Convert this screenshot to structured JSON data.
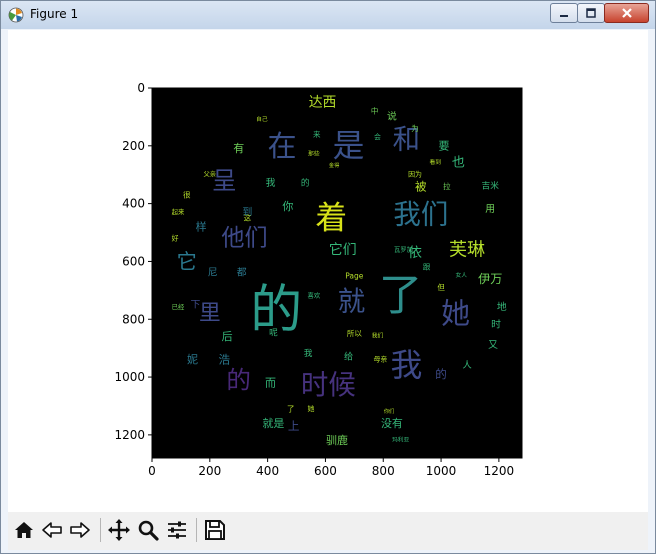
{
  "window": {
    "title": "Figure 1"
  },
  "chart_data": {
    "type": "heatmap",
    "subtype": "word-cloud image",
    "colormap": "viridis",
    "background": "#000000",
    "x_ticks": [
      "0",
      "200",
      "400",
      "600",
      "800",
      "1000",
      "1200"
    ],
    "y_ticks": [
      "0",
      "200",
      "400",
      "600",
      "800",
      "1000",
      "1200"
    ],
    "xlim": [
      0,
      1280
    ],
    "ylim": [
      1280,
      0
    ],
    "words": [
      {
        "text": "的",
        "x": 430,
        "y": 770,
        "size": 180,
        "color": "#2c9c8a"
      },
      {
        "text": "了",
        "x": 860,
        "y": 720,
        "size": 150,
        "color": "#2e8e8c"
      },
      {
        "text": "是",
        "x": 680,
        "y": 200,
        "size": 110,
        "color": "#3b528b"
      },
      {
        "text": "在",
        "x": 450,
        "y": 200,
        "size": 100,
        "color": "#3b528b"
      },
      {
        "text": "和",
        "x": 880,
        "y": 180,
        "size": 95,
        "color": "#3b528b"
      },
      {
        "text": "着",
        "x": 620,
        "y": 450,
        "size": 110,
        "color": "#d8e219"
      },
      {
        "text": "我们",
        "x": 930,
        "y": 440,
        "size": 95,
        "color": "#2c728e"
      },
      {
        "text": "她",
        "x": 1050,
        "y": 780,
        "size": 100,
        "color": "#3e4a89"
      },
      {
        "text": "就",
        "x": 690,
        "y": 740,
        "size": 95,
        "color": "#3b528b"
      },
      {
        "text": "我",
        "x": 880,
        "y": 960,
        "size": 110,
        "color": "#3e4a89"
      },
      {
        "text": "时候",
        "x": 610,
        "y": 1030,
        "size": 95,
        "color": "#46327e"
      },
      {
        "text": "的",
        "x": 300,
        "y": 1010,
        "size": 85,
        "color": "#482878"
      },
      {
        "text": "他们",
        "x": 320,
        "y": 520,
        "size": 80,
        "color": "#3e4a89"
      },
      {
        "text": "呈",
        "x": 250,
        "y": 320,
        "size": 85,
        "color": "#3e4a89"
      },
      {
        "text": "它",
        "x": 120,
        "y": 600,
        "size": 70,
        "color": "#2a788e"
      },
      {
        "text": "里",
        "x": 200,
        "y": 780,
        "size": 75,
        "color": "#3e4a89"
      },
      {
        "text": "芙琳",
        "x": 1090,
        "y": 560,
        "size": 62,
        "color": "#b5de2b"
      },
      {
        "text": "达西",
        "x": 590,
        "y": 50,
        "size": 48,
        "color": "#b5de2b"
      },
      {
        "text": "它们",
        "x": 660,
        "y": 560,
        "size": 48,
        "color": "#35b779"
      },
      {
        "text": "依",
        "x": 910,
        "y": 570,
        "size": 48,
        "color": "#35b779"
      },
      {
        "text": "伊万",
        "x": 1170,
        "y": 660,
        "size": 42,
        "color": "#6ece58"
      },
      {
        "text": "驯鹿",
        "x": 640,
        "y": 1220,
        "size": 38,
        "color": "#6ece58"
      },
      {
        "text": "没有",
        "x": 830,
        "y": 1160,
        "size": 38,
        "color": "#35b779"
      },
      {
        "text": "就是",
        "x": 420,
        "y": 1160,
        "size": 38,
        "color": "#35b779"
      },
      {
        "text": "有",
        "x": 300,
        "y": 210,
        "size": 38,
        "color": "#6ece58"
      },
      {
        "text": "也",
        "x": 1060,
        "y": 260,
        "size": 45,
        "color": "#35b779"
      },
      {
        "text": "被",
        "x": 930,
        "y": 340,
        "size": 40,
        "color": "#b5de2b"
      },
      {
        "text": "要",
        "x": 1010,
        "y": 200,
        "size": 38,
        "color": "#35b779"
      },
      {
        "text": "浩",
        "x": 250,
        "y": 940,
        "size": 40,
        "color": "#2a788e"
      },
      {
        "text": "妮",
        "x": 140,
        "y": 940,
        "size": 38,
        "color": "#2a788e"
      },
      {
        "text": "后",
        "x": 260,
        "y": 860,
        "size": 38,
        "color": "#35b779"
      },
      {
        "text": "而",
        "x": 410,
        "y": 1020,
        "size": 38,
        "color": "#35b779"
      },
      {
        "text": "样",
        "x": 170,
        "y": 480,
        "size": 38,
        "color": "#2a788e"
      },
      {
        "text": "尼",
        "x": 210,
        "y": 640,
        "size": 34,
        "color": "#2a788e"
      },
      {
        "text": "都",
        "x": 310,
        "y": 640,
        "size": 34,
        "color": "#2a788e"
      },
      {
        "text": "你",
        "x": 470,
        "y": 410,
        "size": 38,
        "color": "#35b779"
      },
      {
        "text": "到",
        "x": 330,
        "y": 430,
        "size": 34,
        "color": "#2a788e"
      },
      {
        "text": "说",
        "x": 830,
        "y": 100,
        "size": 34,
        "color": "#6ece58"
      },
      {
        "text": "用",
        "x": 1170,
        "y": 420,
        "size": 34,
        "color": "#6ece58"
      },
      {
        "text": "地",
        "x": 1210,
        "y": 760,
        "size": 34,
        "color": "#35b779"
      },
      {
        "text": "时",
        "x": 1190,
        "y": 820,
        "size": 34,
        "color": "#35b779"
      },
      {
        "text": "又",
        "x": 1180,
        "y": 890,
        "size": 34,
        "color": "#35b779"
      },
      {
        "text": "给",
        "x": 680,
        "y": 930,
        "size": 32,
        "color": "#35b779"
      },
      {
        "text": "Page",
        "x": 700,
        "y": 650,
        "size": 26,
        "color": "#b5de2b"
      },
      {
        "text": "吉米",
        "x": 1170,
        "y": 340,
        "size": 30,
        "color": "#35b779"
      },
      {
        "text": "所以",
        "x": 700,
        "y": 850,
        "size": 26,
        "color": "#b5de2b"
      },
      {
        "text": "因为",
        "x": 910,
        "y": 300,
        "size": 24,
        "color": "#b5de2b"
      },
      {
        "text": "母亲",
        "x": 790,
        "y": 940,
        "size": 24,
        "color": "#b5de2b"
      },
      {
        "text": "上",
        "x": 490,
        "y": 1170,
        "size": 40,
        "color": "#3e4a89"
      },
      {
        "text": "下",
        "x": 150,
        "y": 750,
        "size": 34,
        "color": "#3e4a89"
      },
      {
        "text": "父亲",
        "x": 200,
        "y": 300,
        "size": 22,
        "color": "#b5de2b"
      },
      {
        "text": "瓦罗加",
        "x": 870,
        "y": 560,
        "size": 22,
        "color": "#35b779"
      },
      {
        "text": "中",
        "x": 770,
        "y": 80,
        "size": 26,
        "color": "#6ece58"
      },
      {
        "text": "为",
        "x": 910,
        "y": 140,
        "size": 26,
        "color": "#6ece58"
      },
      {
        "text": "拉",
        "x": 1020,
        "y": 340,
        "size": 26,
        "color": "#6ece58"
      },
      {
        "text": "人",
        "x": 1090,
        "y": 960,
        "size": 32,
        "color": "#35b779"
      },
      {
        "text": "但",
        "x": 1000,
        "y": 690,
        "size": 26,
        "color": "#b5de2b"
      },
      {
        "text": "很",
        "x": 120,
        "y": 370,
        "size": 26,
        "color": "#b5de2b"
      },
      {
        "text": "好",
        "x": 80,
        "y": 520,
        "size": 24,
        "color": "#b5de2b"
      },
      {
        "text": "起来",
        "x": 90,
        "y": 430,
        "size": 22,
        "color": "#b5de2b"
      },
      {
        "text": "这",
        "x": 330,
        "y": 450,
        "size": 26,
        "color": "#b5de2b"
      },
      {
        "text": "呢",
        "x": 420,
        "y": 850,
        "size": 30,
        "color": "#35b779"
      },
      {
        "text": "喜欢",
        "x": 560,
        "y": 720,
        "size": 22,
        "color": "#35b779"
      },
      {
        "text": "了",
        "x": 480,
        "y": 1110,
        "size": 26,
        "color": "#b5de2b"
      },
      {
        "text": "她",
        "x": 550,
        "y": 1110,
        "size": 24,
        "color": "#b5de2b"
      },
      {
        "text": "来",
        "x": 570,
        "y": 160,
        "size": 26,
        "color": "#35b779"
      },
      {
        "text": "那些",
        "x": 560,
        "y": 230,
        "size": 20,
        "color": "#b5de2b"
      },
      {
        "text": "自己",
        "x": 380,
        "y": 110,
        "size": 20,
        "color": "#b5de2b"
      },
      {
        "text": "我",
        "x": 410,
        "y": 330,
        "size": 34,
        "color": "#35b779"
      },
      {
        "text": "的",
        "x": 530,
        "y": 330,
        "size": 30,
        "color": "#35b779"
      },
      {
        "text": "会",
        "x": 780,
        "y": 170,
        "size": 24,
        "color": "#35b779"
      },
      {
        "text": "看到",
        "x": 980,
        "y": 260,
        "size": 20,
        "color": "#b5de2b"
      },
      {
        "text": "我们",
        "x": 780,
        "y": 860,
        "size": 20,
        "color": "#b5de2b"
      },
      {
        "text": "你们",
        "x": 820,
        "y": 1120,
        "size": 18,
        "color": "#b5de2b"
      },
      {
        "text": "玛利亚",
        "x": 860,
        "y": 1220,
        "size": 20,
        "color": "#35b779"
      },
      {
        "text": "我",
        "x": 540,
        "y": 920,
        "size": 30,
        "color": "#35b779"
      },
      {
        "text": "的",
        "x": 1000,
        "y": 990,
        "size": 40,
        "color": "#3e4a89"
      },
      {
        "text": "跟",
        "x": 950,
        "y": 620,
        "size": 26,
        "color": "#35b779"
      },
      {
        "text": "女人",
        "x": 1070,
        "y": 650,
        "size": 20,
        "color": "#35b779"
      },
      {
        "text": "已经",
        "x": 90,
        "y": 760,
        "size": 22,
        "color": "#6ece58"
      },
      {
        "text": "金得",
        "x": 630,
        "y": 270,
        "size": 18,
        "color": "#b5de2b"
      }
    ]
  },
  "toolbar": {
    "icons": [
      "home-icon",
      "back-arrow-icon",
      "forward-arrow-icon",
      "pan-icon",
      "zoom-icon",
      "subplots-icon",
      "save-icon"
    ]
  }
}
